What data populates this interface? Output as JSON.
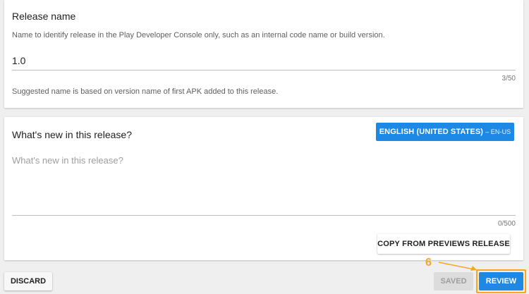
{
  "release_name": {
    "title": "Release name",
    "description": "Name to identify release in the Play Developer Console only, such as an internal code name or build version.",
    "value": "1.0",
    "counter": "3/50",
    "hint": "Suggested name is based on version name of first APK added to this release."
  },
  "whats_new": {
    "title": "What's new in this release?",
    "language_button": {
      "label": "ENGLISH (UNITED STATES)",
      "code": "– EN-US"
    },
    "placeholder": "What's new in this release?",
    "counter": "0/500",
    "copy_button_label": "COPY FROM PREVIEWS RELEASE"
  },
  "footer": {
    "discard_label": "DISCARD",
    "saved_label": "SAVED",
    "review_label": "REVIEW"
  },
  "annotation": {
    "step_number": "6",
    "color": "#f5a623"
  },
  "colors": {
    "accent": "#1e88e5",
    "background": "#efefef",
    "disabled_button": "#dcdcdc"
  }
}
